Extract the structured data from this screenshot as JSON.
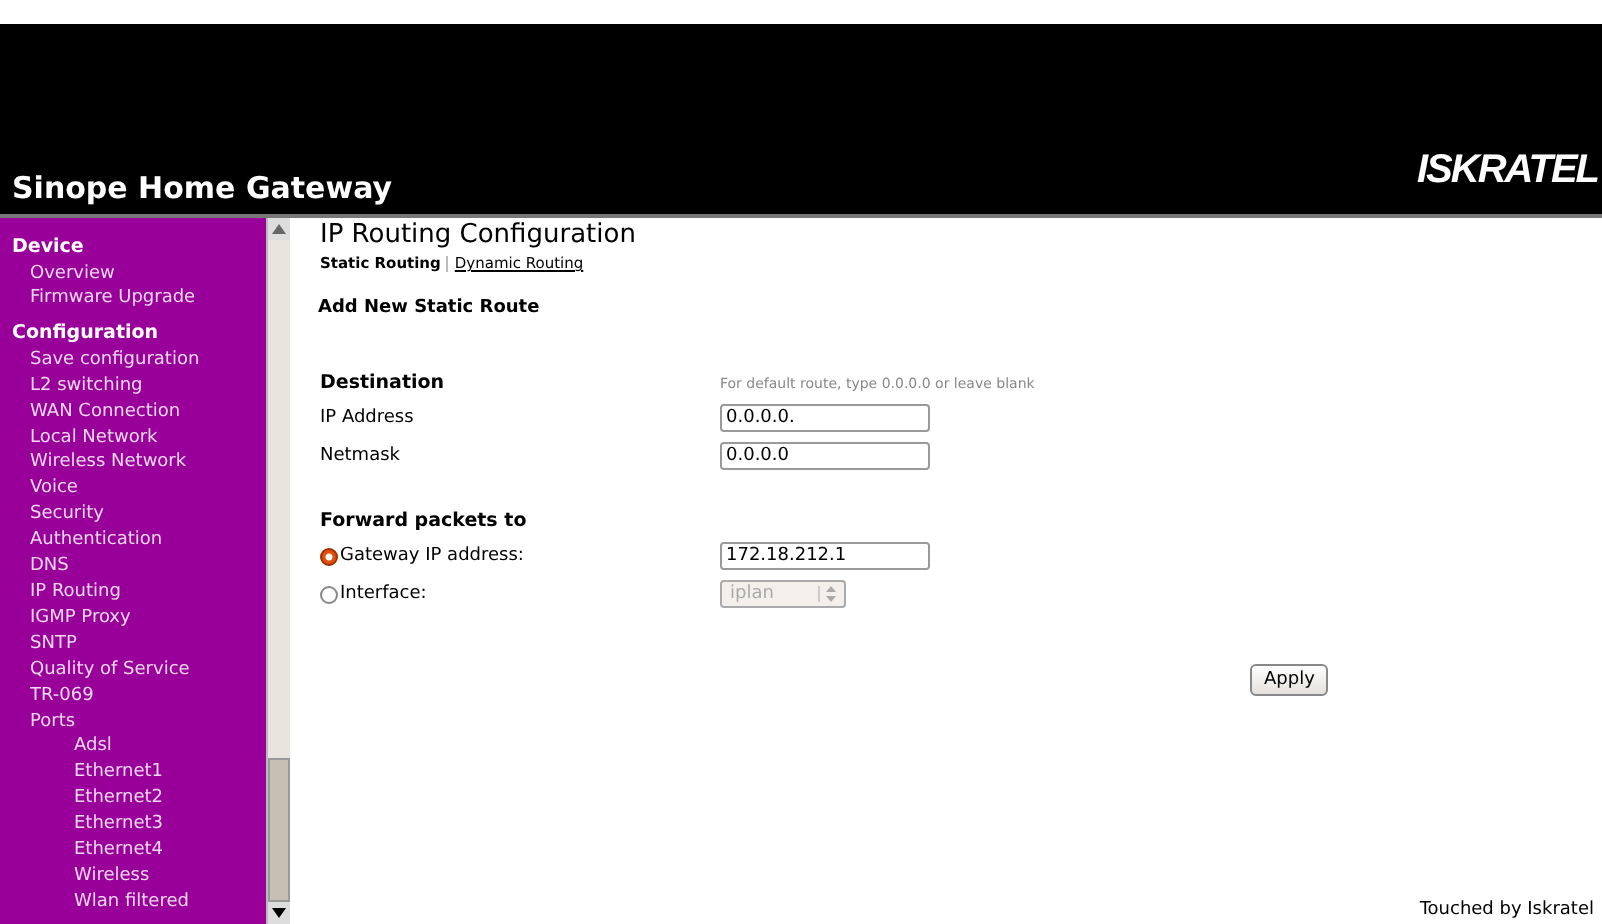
{
  "header": {
    "title": "Sinope Home Gateway",
    "logo": "ISKRATEL"
  },
  "sidebar": {
    "sections": [
      {
        "label": "Device",
        "items": [
          {
            "label": "Overview"
          },
          {
            "label": "Firmware Upgrade"
          }
        ]
      },
      {
        "label": "Configuration",
        "items": [
          {
            "label": "Save configuration"
          },
          {
            "label": "L2 switching"
          },
          {
            "label": "WAN Connection"
          },
          {
            "label": "Local Network"
          },
          {
            "label": "Wireless Network"
          },
          {
            "label": "Voice"
          },
          {
            "label": "Security"
          },
          {
            "label": "Authentication"
          },
          {
            "label": "DNS"
          },
          {
            "label": "IP Routing"
          },
          {
            "label": "IGMP Proxy"
          },
          {
            "label": "SNTP"
          },
          {
            "label": "Quality of Service"
          },
          {
            "label": "TR-069"
          },
          {
            "label": "Ports",
            "children": [
              {
                "label": "Adsl"
              },
              {
                "label": "Ethernet1"
              },
              {
                "label": "Ethernet2"
              },
              {
                "label": "Ethernet3"
              },
              {
                "label": "Ethernet4"
              },
              {
                "label": "Wireless"
              },
              {
                "label": "Wlan filtered"
              }
            ]
          }
        ]
      }
    ]
  },
  "page": {
    "title": "IP Routing Configuration",
    "tabs": [
      {
        "label": "Static Routing",
        "selected": true
      },
      {
        "label": "Dynamic Routing",
        "selected": false
      }
    ],
    "subtitle": "Add New Static Route",
    "destination": {
      "heading": "Destination",
      "hint": "For default route, type 0.0.0.0 or leave blank",
      "fields": [
        {
          "label": "IP Address",
          "value": "0.0.0.0."
        },
        {
          "label": "Netmask",
          "value": "0.0.0.0"
        }
      ]
    },
    "forward": {
      "heading": "Forward packets to",
      "options": [
        {
          "label": "Gateway IP address:",
          "selected": true,
          "kind": "text",
          "value": "172.18.212.1"
        },
        {
          "label": "Interface:",
          "selected": false,
          "kind": "select",
          "value": "iplan"
        }
      ]
    },
    "apply": "Apply"
  },
  "footer": "Touched by Iskratel"
}
